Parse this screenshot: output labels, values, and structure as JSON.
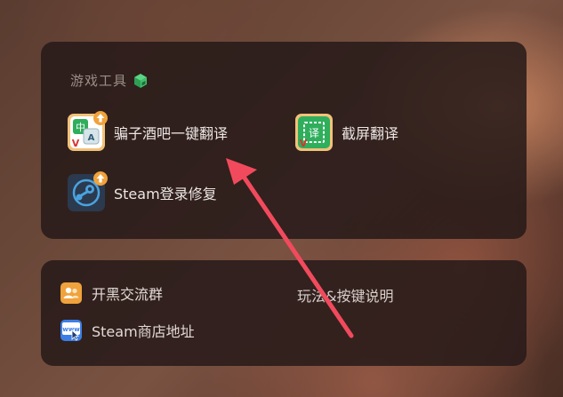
{
  "tools_panel": {
    "title": "游戏工具",
    "items": [
      {
        "label": "骗子酒吧一键翻译",
        "badge": "V",
        "icon_text_1": "中",
        "icon_text_2": "A"
      },
      {
        "label": "截屏翻译",
        "badge": "V",
        "icon_text": "译"
      },
      {
        "label": "Steam登录修复"
      }
    ]
  },
  "links_panel": {
    "items": [
      {
        "label": "开黑交流群"
      },
      {
        "label": "玩法&按键说明"
      },
      {
        "label": "Steam商店地址",
        "icon_text": "www"
      }
    ]
  },
  "colors": {
    "panel_bg": "#261a18",
    "arrow": "#f24a5d",
    "cube_icon": "#3fbf6a",
    "update_badge": "#f0a23c"
  }
}
